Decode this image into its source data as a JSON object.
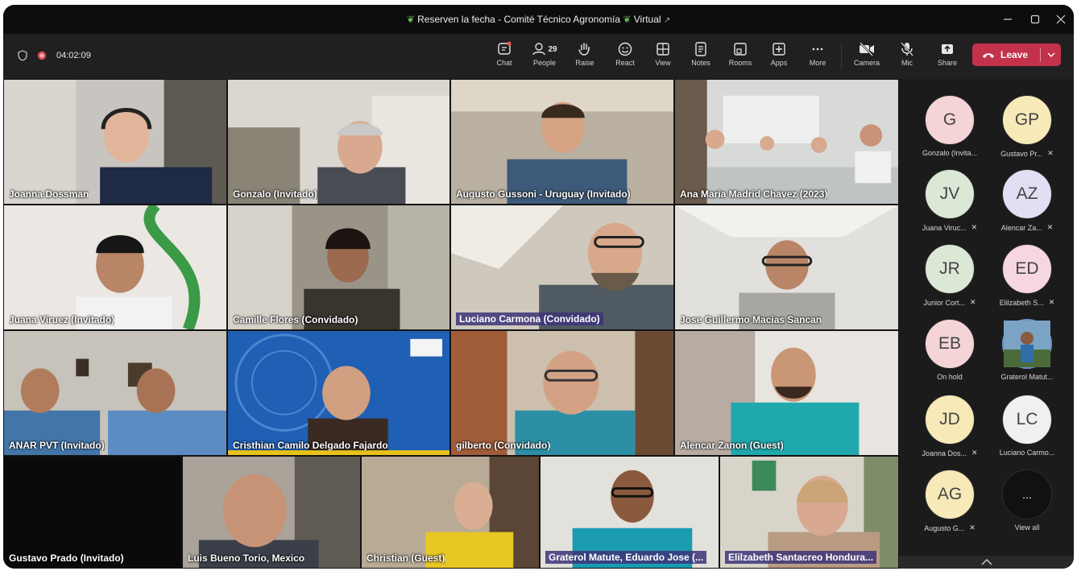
{
  "window": {
    "title": "Reserven la fecha - Comité Técnico Agronomía",
    "title_tag": "Virtual",
    "title_badge": "↗"
  },
  "recording": {
    "timer": "04:02:09"
  },
  "toolbar": {
    "chat": "Chat",
    "people": "People",
    "people_count": "29",
    "raise": "Raise",
    "react": "React",
    "view": "View",
    "notes": "Notes",
    "rooms": "Rooms",
    "apps": "Apps",
    "more": "More",
    "camera": "Camera",
    "mic": "Mic",
    "share": "Share",
    "leave": "Leave"
  },
  "tiles": [
    {
      "name": "Joanna Dossman"
    },
    {
      "name": "Gonzalo (Invitado)"
    },
    {
      "name": "Augusto Gussoni - Uruguay (Invitado)"
    },
    {
      "name": "Ana Maria Madrid Chavez (2023)"
    },
    {
      "name": "Juana Viruez (Invitado)"
    },
    {
      "name": "Camille Flores (Convidado)"
    },
    {
      "name": "Luciano Carmona (Convidado)"
    },
    {
      "name": "Jose Guillermo Macias Sancan"
    },
    {
      "name": "ANAR PVT (Invitado)"
    },
    {
      "name": "Cristhian Camilo Delgado Fajardo"
    },
    {
      "name": "gilberto (Convidado)"
    },
    {
      "name": "Alencar Zanon  (Guest)"
    },
    {
      "name": "Gustavo Prado (Invitado)"
    },
    {
      "name": "Luis Bueno Torio,  Mexico"
    },
    {
      "name": "Christian (Guest)"
    },
    {
      "name": "Graterol Matute, Eduardo Jose (..."
    },
    {
      "name": "Elilzabeth Santacreo Hondura..."
    }
  ],
  "side_panel": [
    {
      "initials": "G",
      "label": "Gonzalo (Invita...",
      "color": "#f4d4d6"
    },
    {
      "initials": "GP",
      "label": "Gustavo Pr...",
      "color": "#f7e9b8"
    },
    {
      "initials": "JV",
      "label": "Juana Viruc...",
      "color": "#dce8d6"
    },
    {
      "initials": "AZ",
      "label": "Alencar Za...",
      "color": "#e1dff3"
    },
    {
      "initials": "JR",
      "label": "Junior Cort...",
      "color": "#dce8d6"
    },
    {
      "initials": "ED",
      "label": "Elilzabeth S...",
      "color": "#f7d6e4"
    },
    {
      "initials": "EB",
      "label": "On hold",
      "color": "#f4d4d6"
    },
    {
      "initials": "",
      "label": "Graterol Matut...",
      "color": "#3c5a78"
    },
    {
      "initials": "JD",
      "label": "Joanna Dos...",
      "color": "#f7e9b8"
    },
    {
      "initials": "LC",
      "label": "Luciano Carmo...",
      "color": "#f0f0f0"
    },
    {
      "initials": "AG",
      "label": "Augusto G...",
      "color": "#f7e9b8"
    },
    {
      "initials": "...",
      "label": "View all",
      "color": "#111111"
    }
  ]
}
